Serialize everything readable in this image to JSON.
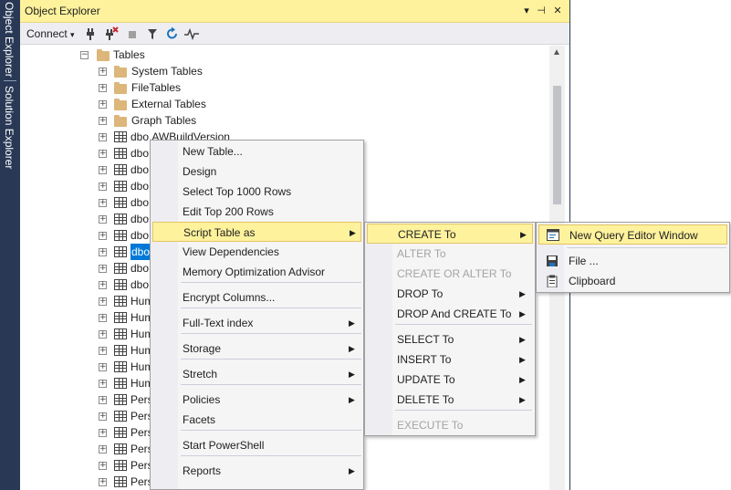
{
  "side_tabs": [
    "Object Explorer",
    "Solution Explorer"
  ],
  "panel": {
    "title": "Object Explorer",
    "title_buttons": [
      "▾",
      "⊣",
      "✕"
    ],
    "toolbar": {
      "connect_label": "Connect",
      "connect_arrow": "▾"
    }
  },
  "tree": {
    "tables_label": "Tables",
    "folders": [
      "System Tables",
      "FileTables",
      "External Tables",
      "Graph Tables"
    ],
    "rows": [
      "dbo.AWBuildVersion",
      "dbo",
      "dbo",
      "dbo",
      "dbo",
      "dbo",
      "dbo",
      "dbo",
      "dbo",
      "dbo",
      "Hum",
      "Hum",
      "Hum",
      "Hum",
      "Hum",
      "Hum",
      "Pers",
      "Pers",
      "Pers",
      "Pers",
      "Pers",
      "Pers"
    ],
    "selected_row_index": 7
  },
  "context_menu": {
    "items": [
      {
        "label": "New Table...",
        "submenu": false
      },
      {
        "label": "Design",
        "submenu": false
      },
      {
        "label": "Select Top 1000 Rows",
        "submenu": false
      },
      {
        "label": "Edit Top 200 Rows",
        "submenu": false
      },
      {
        "label": "Script Table as",
        "submenu": true,
        "highlighted": true
      },
      {
        "label": "View Dependencies",
        "submenu": false
      },
      {
        "label": "Memory Optimization Advisor",
        "submenu": false
      },
      {
        "label": "Encrypt Columns...",
        "submenu": false
      },
      {
        "label": "Full-Text index",
        "submenu": true
      },
      {
        "label": "Storage",
        "submenu": true
      },
      {
        "label": "Stretch",
        "submenu": true
      },
      {
        "label": "Policies",
        "submenu": true
      },
      {
        "label": "Facets",
        "submenu": false
      },
      {
        "label": "Start PowerShell",
        "submenu": false
      },
      {
        "label": "Reports",
        "submenu": true
      }
    ]
  },
  "script_menu": {
    "items": [
      {
        "label": "CREATE To",
        "submenu": true,
        "highlighted": true,
        "disabled": false
      },
      {
        "label": "ALTER To",
        "submenu": false,
        "disabled": true
      },
      {
        "label": "CREATE OR ALTER To",
        "submenu": false,
        "disabled": true
      },
      {
        "label": "DROP To",
        "submenu": true,
        "disabled": false
      },
      {
        "label": "DROP And CREATE To",
        "submenu": true,
        "disabled": false
      },
      {
        "label": "SELECT To",
        "submenu": true,
        "disabled": false
      },
      {
        "label": "INSERT To",
        "submenu": true,
        "disabled": false
      },
      {
        "label": "UPDATE To",
        "submenu": true,
        "disabled": false
      },
      {
        "label": "DELETE To",
        "submenu": true,
        "disabled": false
      },
      {
        "label": "EXECUTE To",
        "submenu": false,
        "disabled": true
      }
    ]
  },
  "create_menu": {
    "items": [
      {
        "label": "New Query Editor Window",
        "icon": "query-window-icon",
        "highlighted": true
      },
      {
        "label": "File ...",
        "icon": "save-file-icon"
      },
      {
        "label": "Clipboard",
        "icon": "clipboard-icon"
      }
    ]
  },
  "glyphs": {
    "submenu_arrow": "▶",
    "expand": "+",
    "collapse": "−",
    "scroll_up": "▲"
  }
}
